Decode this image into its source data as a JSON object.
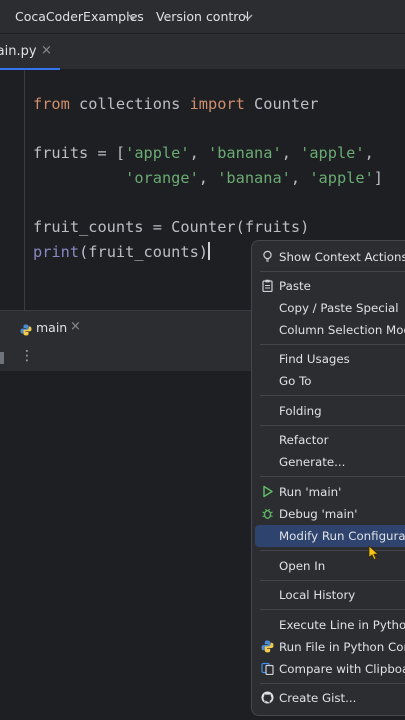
{
  "titlebar": {
    "project": "CocaCoderExamples",
    "vcs": "Version control"
  },
  "editor_tab": {
    "label": "main.py",
    "close_glyph": "×"
  },
  "code": {
    "l1": {
      "kw1": "from",
      "mod": " collections ",
      "kw2": "import",
      "name": " Counter"
    },
    "l2": {
      "p1": "fruits = [",
      "s1": "'apple'",
      "c1": ", ",
      "s2": "'banana'",
      "c2": ", ",
      "s3": "'apple'",
      "c3": ","
    },
    "l3": {
      "indent": "          ",
      "s1": "'orange'",
      "c1": ", ",
      "s2": "'banana'",
      "c2": ", ",
      "s3": "'apple'",
      "end": "]"
    },
    "l4": {
      "text": "fruit_counts = Counter(fruits)"
    },
    "l5": {
      "fn": "print",
      "rest": "(fruit_counts)"
    }
  },
  "run_panel": {
    "tab_label": "main",
    "close_glyph": "×",
    "menu_glyph": "⋮"
  },
  "context_menu": {
    "items": [
      {
        "label": "Show Context Actions",
        "icon": "bulb-icon"
      },
      {
        "label": "Paste",
        "icon": "clipboard-icon"
      },
      {
        "label": "Copy / Paste Special"
      },
      {
        "label": "Column Selection Mode"
      },
      {
        "label": "Find Usages"
      },
      {
        "label": "Go To"
      },
      {
        "label": "Folding"
      },
      {
        "label": "Refactor"
      },
      {
        "label": "Generate..."
      },
      {
        "label": "Run 'main'",
        "icon": "run-icon",
        "color": "#5fb865"
      },
      {
        "label": "Debug 'main'",
        "icon": "debug-icon",
        "color": "#5fb865"
      },
      {
        "label": "Modify Run Configuration...",
        "selected": true
      },
      {
        "label": "Open In"
      },
      {
        "label": "Local History"
      },
      {
        "label": "Execute Line in Python Console"
      },
      {
        "label": "Run File in Python Console",
        "icon": "python-icon"
      },
      {
        "label": "Compare with Clipboard",
        "icon": "compare-icon"
      },
      {
        "label": "Create Gist...",
        "icon": "github-icon"
      }
    ]
  },
  "colors": {
    "selection": "#2e436e",
    "tab_underline": "#3574f0",
    "keyword": "#cf8e6d",
    "string": "#6aab73",
    "builtin": "#8888c6",
    "cursor": "#f5c518"
  }
}
